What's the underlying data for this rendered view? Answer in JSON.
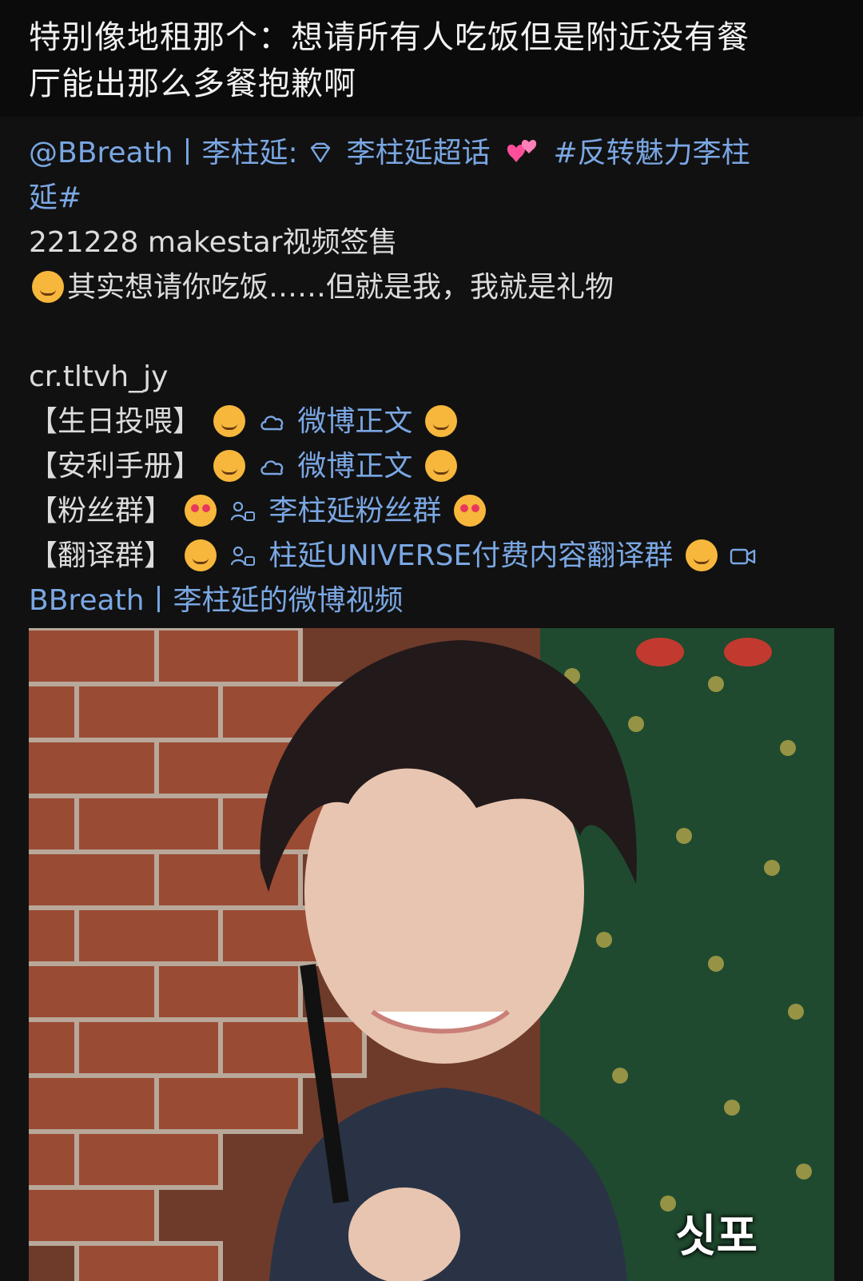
{
  "top_post": {
    "text_line1": "特别像地租那个：想请所有人吃饭但是附近没有餐",
    "text_line2": "厅能出那么多餐抱歉啊"
  },
  "repost": {
    "author_line1": "@BBreath丨李柱延:",
    "supertopic": "李柱延超话",
    "hashtag_part1": "#反转魅力李柱",
    "hashtag_part2": "延#",
    "line_makestar": "221228 makestar视频签售",
    "line_quote": "其实想请你吃饭……但就是我，我就是礼物",
    "credit": "cr.tltvh_jy",
    "items": [
      {
        "bracket": "【生日投喂】",
        "link": "微博正文",
        "emoji": "cat"
      },
      {
        "bracket": "【安利手册】",
        "link": "微博正文",
        "emoji": "cat"
      },
      {
        "bracket": "【粉丝群】",
        "link": "李柱延粉丝群",
        "emoji": "heart-eyes"
      },
      {
        "bracket": "【翻译群】",
        "link": "柱延UNIVERSE付费内容翻译群",
        "emoji": "cat"
      }
    ],
    "video_link": "BBreath丨李柱延的微博视频"
  },
  "video": {
    "caption": "싯포"
  },
  "colors": {
    "link": "#7aa7e3",
    "top_bg": "#0b0b0b",
    "repost_bg": "#111111"
  },
  "icons": {
    "supertopic": "diamond-icon",
    "hearts": "two-hearts-icon",
    "weibo_text": "cloud-icon",
    "group": "group-chat-icon",
    "video": "video-camera-icon"
  }
}
